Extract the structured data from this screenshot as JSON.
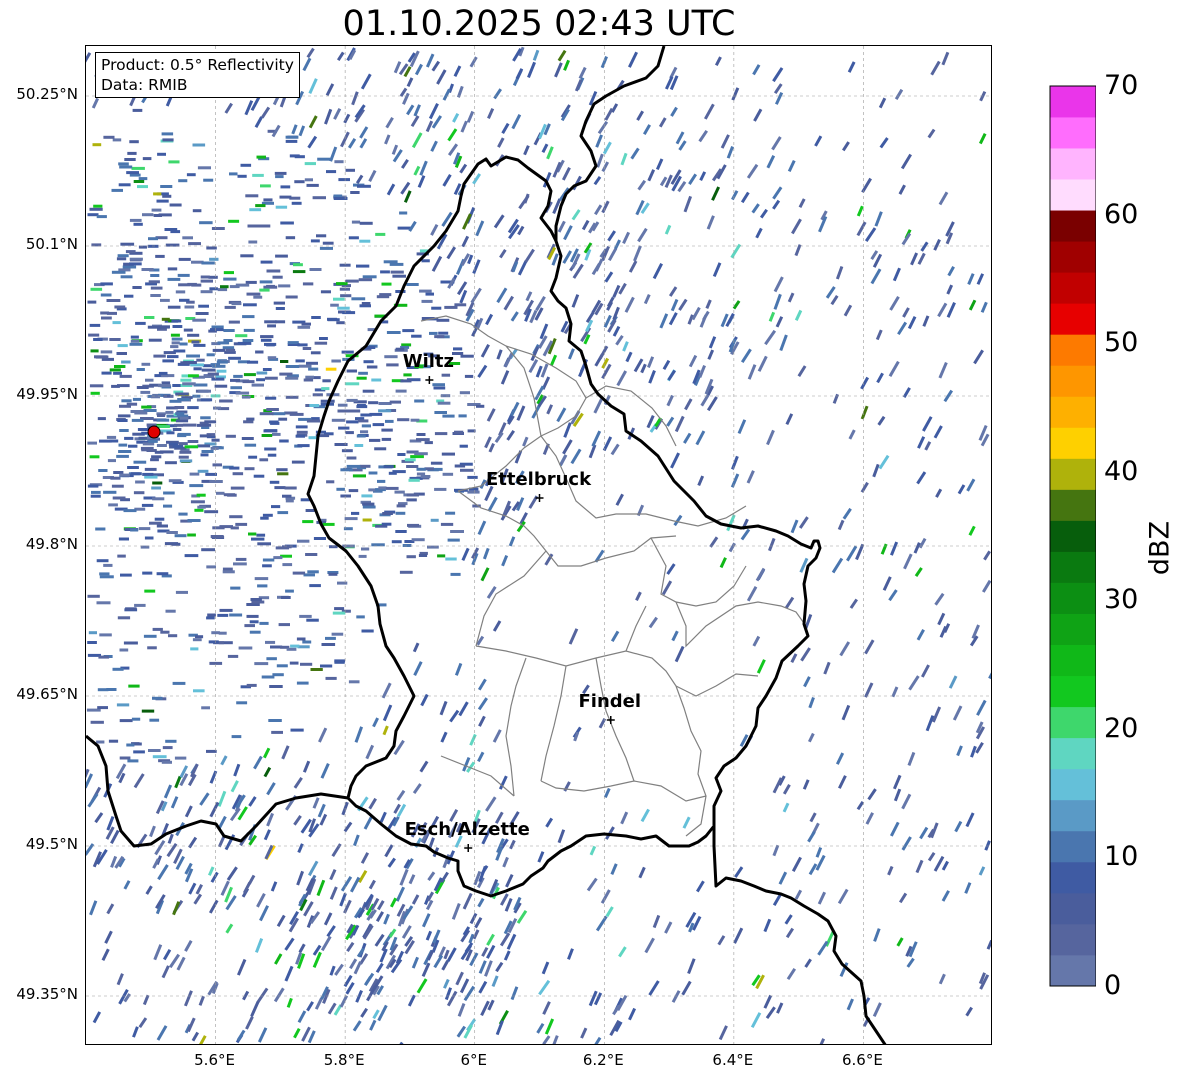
{
  "title": "01.10.2025 02:43 UTC",
  "info_box": {
    "product": "Product: 0.5° Reflectivity",
    "data_source": "Data: RMIB"
  },
  "map": {
    "lon_range": [
      5.4,
      6.8
    ],
    "lat_range": [
      49.3,
      50.3
    ],
    "lat_ticks": [
      {
        "value": 50.25,
        "label": "50.25°N"
      },
      {
        "value": 50.1,
        "label": "50.1°N"
      },
      {
        "value": 49.95,
        "label": "49.95°N"
      },
      {
        "value": 49.8,
        "label": "49.8°N"
      },
      {
        "value": 49.65,
        "label": "49.65°N"
      },
      {
        "value": 49.5,
        "label": "49.5°N"
      },
      {
        "value": 49.35,
        "label": "49.35°N"
      }
    ],
    "lon_ticks": [
      {
        "value": 5.6,
        "label": "5.6°E"
      },
      {
        "value": 5.8,
        "label": "5.8°E"
      },
      {
        "value": 6.0,
        "label": "6°E"
      },
      {
        "value": 6.2,
        "label": "6.2°E"
      },
      {
        "value": 6.4,
        "label": "6.4°E"
      },
      {
        "value": 6.6,
        "label": "6.6°E"
      }
    ],
    "radar_site": {
      "lon": 5.505,
      "lat": 49.914,
      "color": "#e00000"
    },
    "cities": [
      {
        "name": "Wiltz",
        "lon": 5.93,
        "lat": 49.966
      },
      {
        "name": "Ettelbruck",
        "lon": 6.1,
        "lat": 49.848
      },
      {
        "name": "Findel",
        "lon": 6.21,
        "lat": 49.626
      },
      {
        "name": "Esch/Alzette",
        "lon": 5.99,
        "lat": 49.498
      }
    ]
  },
  "colorbar": {
    "label": "dBZ",
    "min": 0,
    "max": 70,
    "ticks": [
      {
        "value": 0,
        "label": "0"
      },
      {
        "value": 10,
        "label": "10"
      },
      {
        "value": 20,
        "label": "20"
      },
      {
        "value": 30,
        "label": "30"
      },
      {
        "value": 40,
        "label": "40"
      },
      {
        "value": 50,
        "label": "50"
      },
      {
        "value": 60,
        "label": "60"
      },
      {
        "value": 70,
        "label": "70"
      }
    ],
    "colors": [
      "#6577aa",
      "#56659e",
      "#4a5d9c",
      "#3f5ba3",
      "#4a76af",
      "#5a9ac6",
      "#64c0d9",
      "#5fd6c1",
      "#3ed76c",
      "#12c81f",
      "#10b818",
      "#0fa315",
      "#0c8f13",
      "#0a7a10",
      "#075e0c",
      "#457510",
      "#afb20b",
      "#fed000",
      "#feb000",
      "#fe9600",
      "#fd7a00",
      "#e70000",
      "#c10000",
      "#a00000",
      "#7a0000",
      "#ffdcfe",
      "#ffb4fe",
      "#ff6dfd",
      "#ea35ea"
    ]
  }
}
